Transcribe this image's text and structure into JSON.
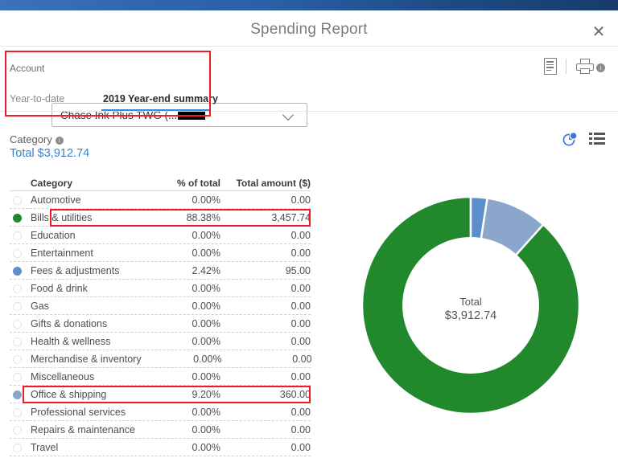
{
  "window": {
    "title": "Spending Report",
    "close_label": "✕"
  },
  "account": {
    "label": "Account",
    "value_prefix": "Chase Ink Plus TWG (...",
    "redacted": true,
    "chevron_icon": "chevron-down-icon"
  },
  "tabs": [
    {
      "label": "Year-to-date",
      "active": false
    },
    {
      "label": "2019 Year-end summary",
      "active": true
    }
  ],
  "toolbar": {
    "report_icon": "document-report-icon",
    "print_icon": "printer-icon",
    "info_badge": "i"
  },
  "category_header": {
    "label": "Category",
    "info_icon": "info-icon",
    "total_label": "Total $3,912.74"
  },
  "view_toggle": {
    "chart_icon": "pie-chart-icon",
    "list_icon": "list-view-icon",
    "active": "pie-chart-icon"
  },
  "table": {
    "columns": [
      "Category",
      "% of total",
      "Total amount ($)"
    ],
    "rows": [
      {
        "name": "Automotive",
        "pct": "0.00%",
        "amount": "0.00",
        "color": null
      },
      {
        "name": "Bills & utilities",
        "pct": "88.38%",
        "amount": "3,457.74",
        "color": "#22882c"
      },
      {
        "name": "Education",
        "pct": "0.00%",
        "amount": "0.00",
        "color": null
      },
      {
        "name": "Entertainment",
        "pct": "0.00%",
        "amount": "0.00",
        "color": null
      },
      {
        "name": "Fees & adjustments",
        "pct": "2.42%",
        "amount": "95.00",
        "color": "#5b8ecb"
      },
      {
        "name": "Food & drink",
        "pct": "0.00%",
        "amount": "0.00",
        "color": null
      },
      {
        "name": "Gas",
        "pct": "0.00%",
        "amount": "0.00",
        "color": null
      },
      {
        "name": "Gifts & donations",
        "pct": "0.00%",
        "amount": "0.00",
        "color": null
      },
      {
        "name": "Health & wellness",
        "pct": "0.00%",
        "amount": "0.00",
        "color": null
      },
      {
        "name": "Merchandise & inventory",
        "pct": "0.00%",
        "amount": "0.00",
        "color": null
      },
      {
        "name": "Miscellaneous",
        "pct": "0.00%",
        "amount": "0.00",
        "color": null
      },
      {
        "name": "Office & shipping",
        "pct": "9.20%",
        "amount": "360.00",
        "color": "#8ba6cb"
      },
      {
        "name": "Professional services",
        "pct": "0.00%",
        "amount": "0.00",
        "color": null
      },
      {
        "name": "Repairs & maintenance",
        "pct": "0.00%",
        "amount": "0.00",
        "color": null
      },
      {
        "name": "Travel",
        "pct": "0.00%",
        "amount": "0.00",
        "color": null
      }
    ]
  },
  "donut": {
    "center_label": "Total",
    "center_value": "$3,912.74"
  },
  "chart_data": {
    "type": "pie",
    "title": "",
    "categories": [
      "Bills & utilities",
      "Office & shipping",
      "Fees & adjustments"
    ],
    "values": [
      3457.74,
      360.0,
      95.0
    ],
    "percents": [
      88.38,
      9.2,
      2.42
    ],
    "colors": [
      "#22882c",
      "#8ba6cb",
      "#5b8ecb"
    ],
    "total": 3912.74,
    "total_label": "Total",
    "total_display": "$3,912.74",
    "donut": true,
    "inner_radius_ratio": 0.62,
    "start_angle_deg": -90,
    "direction": "counterclockwise",
    "legend": "table",
    "xlabel": "",
    "ylabel": ""
  },
  "annotations": {
    "boxes": [
      {
        "name": "account-and-tabs-highlight"
      },
      {
        "name": "bills-and-utilities-row-highlight"
      },
      {
        "name": "office-and-shipping-row-highlight"
      }
    ],
    "color": "#ee1c25"
  }
}
